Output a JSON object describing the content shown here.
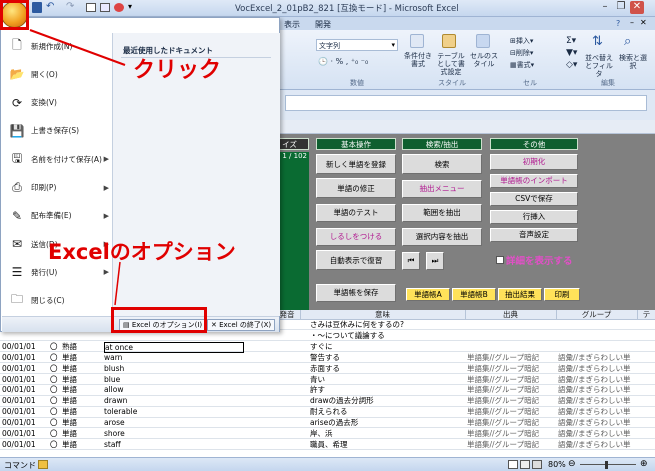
{
  "window": {
    "title": "VocExcel_2_01pB2_821 [互換モード] - Microsoft Excel",
    "quick_access": [
      "save-icon",
      "undo-icon",
      "redo-icon",
      "print-preview-icon"
    ]
  },
  "ribbon": {
    "tabs": [
      "表示",
      "開発"
    ],
    "number_format": "文字列",
    "number_group_label": "数値",
    "style_buttons": [
      "条件付き書式",
      "テーブルとして書式設定",
      "セルのスタイル"
    ],
    "style_group_label": "スタイル",
    "cell_buttons": [
      "挿入",
      "削除",
      "書式"
    ],
    "cell_group_label": "セル",
    "edit_buttons": [
      "並べ替えとフィルタ",
      "検索と選択"
    ],
    "edit_group_label": "編集"
  },
  "office_menu": {
    "recent_header": "最近使用したドキュメント",
    "items": [
      {
        "label": "新規作成(N)",
        "icon": "new-document-icon",
        "arrow": false
      },
      {
        "label": "開く(O)",
        "icon": "open-folder-icon",
        "arrow": false
      },
      {
        "label": "変換(V)",
        "icon": "convert-icon",
        "arrow": false
      },
      {
        "label": "上書き保存(S)",
        "icon": "save-icon",
        "arrow": false
      },
      {
        "label": "名前を付けて保存(A)",
        "icon": "save-as-icon",
        "arrow": true
      },
      {
        "label": "印刷(P)",
        "icon": "print-icon",
        "arrow": true
      },
      {
        "label": "配布準備(E)",
        "icon": "prepare-icon",
        "arrow": true
      },
      {
        "label": "送信(D)",
        "icon": "send-icon",
        "arrow": true
      },
      {
        "label": "発行(U)",
        "icon": "publish-icon",
        "arrow": true
      },
      {
        "label": "閉じる(C)",
        "icon": "close-folder-icon",
        "arrow": false
      }
    ],
    "options_button": "Excel のオプション(I)",
    "exit_button": "Excel の終了(X)"
  },
  "annotations": {
    "click_label": "クリック",
    "options_label": "Excelのオプション"
  },
  "panel": {
    "left_header": "イズ",
    "counter": "1 / 102",
    "headers": [
      "基本操作",
      "検索/抽出",
      "その他"
    ],
    "col1": [
      "新しく単語を登録",
      "単語の修正",
      "単語のテスト",
      "しるしをつける",
      "自動表示で復習"
    ],
    "col2": [
      "検索",
      "抽出メニュー",
      "範囲を抽出",
      "選択内容を抽出"
    ],
    "col3": [
      "初期化",
      "単語帳のインポート",
      "CSVで保存",
      "行挿入",
      "音声設定"
    ],
    "details_label": "詳細を表示する",
    "save_button": "単語帳を保存",
    "book_buttons": [
      "単語帳A",
      "単語帳B",
      "抽出結果",
      "印刷"
    ]
  },
  "grid": {
    "headers": [
      "発音",
      "意味",
      "出典",
      "グループ",
      "テ"
    ],
    "rows": [
      {
        "date": "",
        "mark": "",
        "type": "",
        "word": "",
        "meaning": "さみは豆休みに何をするの?",
        "source": "",
        "group": ""
      },
      {
        "date": "",
        "mark": "",
        "type": "",
        "word": "",
        "meaning": "・〜について議論する",
        "source": "",
        "group": ""
      },
      {
        "date": "00/01/01",
        "mark": "〇",
        "type": "熟語",
        "word": "at once",
        "meaning": "すぐに",
        "source": "",
        "group": ""
      },
      {
        "date": "00/01/01",
        "mark": "〇",
        "type": "単語",
        "word": "warn",
        "meaning": "警告する",
        "source": "単語集//グループ暗記",
        "group": "語彙//まぎらわしい単"
      },
      {
        "date": "00/01/01",
        "mark": "〇",
        "type": "単語",
        "word": "blush",
        "meaning": "赤面する",
        "source": "単語集//グループ暗記",
        "group": "語彙//まぎらわしい単"
      },
      {
        "date": "00/01/01",
        "mark": "〇",
        "type": "単語",
        "word": "blue",
        "meaning": "青い",
        "source": "単語集//グループ暗記",
        "group": "語彙//まぎらわしい単"
      },
      {
        "date": "00/01/01",
        "mark": "〇",
        "type": "単語",
        "word": "allow",
        "meaning": "許す",
        "source": "単語集//グループ暗記",
        "group": "語彙//まぎらわしい単"
      },
      {
        "date": "00/01/01",
        "mark": "〇",
        "type": "単語",
        "word": "drawn",
        "meaning": "drawの過去分詞形",
        "source": "単語集//グループ暗記",
        "group": "語彙//まぎらわしい単"
      },
      {
        "date": "00/01/01",
        "mark": "〇",
        "type": "単語",
        "word": "tolerable",
        "meaning": "耐えられる",
        "source": "単語集//グループ暗記",
        "group": "語彙//まぎらわしい単"
      },
      {
        "date": "00/01/01",
        "mark": "〇",
        "type": "単語",
        "word": "arose",
        "meaning": "ariseの過去形",
        "source": "単語集//グループ暗記",
        "group": "語彙//まぎらわしい単"
      },
      {
        "date": "00/01/01",
        "mark": "〇",
        "type": "単語",
        "word": "shore",
        "meaning": "岸、浜",
        "source": "単語集//グループ暗記",
        "group": "語彙//まぎらわしい単"
      },
      {
        "date": "00/01/01",
        "mark": "〇",
        "type": "単語",
        "word": "staff",
        "meaning": "職員、希理",
        "source": "単語集//グループ暗記",
        "group": "語彙//まぎらわしい単"
      }
    ]
  },
  "status": {
    "mode": "コマンド",
    "zoom": "80%"
  },
  "colors": {
    "annotation_red": "#e00000",
    "panel_green": "#0f5f2f"
  }
}
